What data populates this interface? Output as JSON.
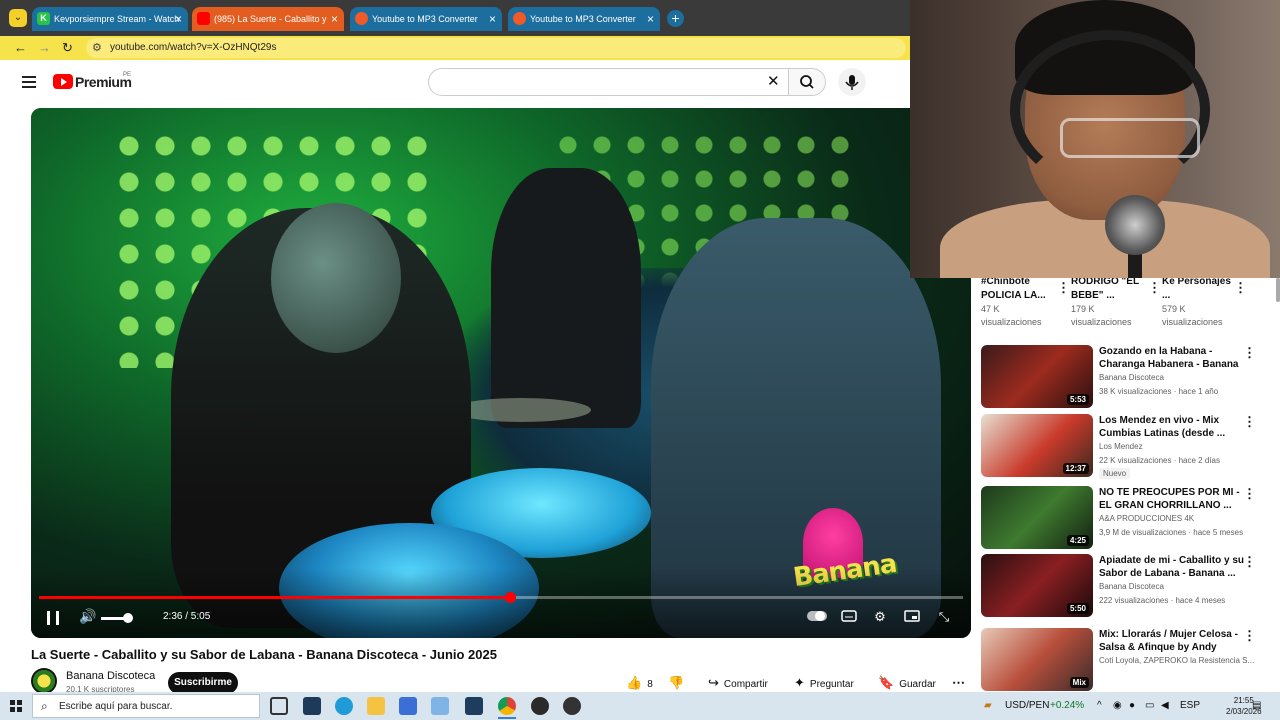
{
  "browser": {
    "tabs": [
      {
        "title": "Kevporsiempre Stream - Watch"
      },
      {
        "title": "(985) La Suerte - Caballito y"
      },
      {
        "title": "Youtube to MP3 Converter"
      },
      {
        "title": "Youtube to MP3 Converter"
      }
    ],
    "url": "youtube.com/watch?v=X-OzHNQt29s"
  },
  "yt": {
    "logo_text": "Premium",
    "region": "PE"
  },
  "player": {
    "time": "2:36 / 5:05",
    "progress": 0.51,
    "volume": 0.7,
    "overlay_text": "Banana"
  },
  "video": {
    "title": "La Suerte - Caballito y su Sabor de Labana - Banana Discoteca - Junio 2025",
    "channel": "Banana Discoteca",
    "subscribers": "20,1 K suscriptores",
    "subscribe_label": "Suscribirme",
    "likes": "8",
    "share_label": "Compartir",
    "ask_label": "Preguntar",
    "save_label": "Guardar"
  },
  "top_row": [
    {
      "title": "#Chinbote POLICIA LA...",
      "views": "47 K",
      "views_label": "visualizaciones"
    },
    {
      "title": "RODRIGO \"EL BEBE\" ...",
      "views": "179 K",
      "views_label": "visualizaciones"
    },
    {
      "title": "Ke Personajes ...",
      "views": "579 K",
      "views_label": "visualizaciones"
    }
  ],
  "recommendations": [
    {
      "title": "Gozando en la Habana - Charanga Habanera - Banana ...",
      "channel": "Banana Discoteca",
      "meta": "38 K visualizaciones · hace 1 año",
      "duration": "5:53"
    },
    {
      "title": "Los Mendez en vivo - Mix Cumbias Latinas (desde ...",
      "channel": "Los Mendez",
      "meta": "22 K visualizaciones · hace 2 días",
      "duration": "12:37",
      "badge": "Nuevo"
    },
    {
      "title": "NO TE PREOCUPES POR MI - EL GRAN CHORRILLANO ...",
      "channel": "A&A PRODUCCIONES 4K",
      "meta": "3,9 M de visualizaciones · hace 5 meses",
      "duration": "4:25"
    },
    {
      "title": "Apiadate de mi - Caballito y su Sabor de Labana - Banana ...",
      "channel": "Banana Discoteca",
      "meta": "222 visualizaciones · hace 4 meses",
      "duration": "5:50"
    },
    {
      "title": "Mix: Llorarás / Mujer Celosa - Salsa & Afinque by Andy Cháv...",
      "channel": "Coti Loyola, ZAPEROKO la Resistencia S...",
      "meta": "",
      "duration": "Mix"
    }
  ],
  "taskbar": {
    "search_placeholder": "Escribe aquí para buscar.",
    "currency": "USD/PEN",
    "currency_change": "+0.24%",
    "lang": "ESP",
    "time": "21:55",
    "date": "2/03/2026"
  }
}
